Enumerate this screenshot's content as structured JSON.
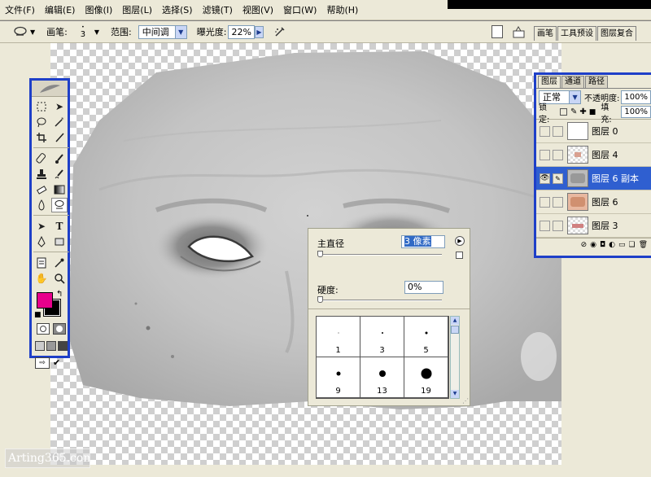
{
  "menu": {
    "items": [
      "文件(F)",
      "编辑(E)",
      "图像(I)",
      "图层(L)",
      "选择(S)",
      "滤镜(T)",
      "视图(V)",
      "窗口(W)",
      "帮助(H)"
    ]
  },
  "options_bar": {
    "tool_icon": "dodge-tool-icon",
    "brush_label": "画笔:",
    "brush_size": "3",
    "range_label": "范围:",
    "range_value": "中间调",
    "exposure_label": "曝光度:",
    "exposure_value": "22%",
    "airbrush_icon": "airbrush-icon"
  },
  "palette_well": {
    "tabs": [
      "画笔",
      "工具预设",
      "图层复合"
    ]
  },
  "toolbox": {
    "fg_color": "#E8008C",
    "bg_color": "#000000",
    "tools": [
      "marquee-icon",
      "move-icon",
      "lasso-icon",
      "magic-wand-icon",
      "crop-icon",
      "slice-icon",
      "healing-brush-icon",
      "brush-icon",
      "clone-stamp-icon",
      "history-brush-icon",
      "eraser-icon",
      "gradient-icon",
      "blur-icon",
      "dodge-icon",
      "path-select-icon",
      "type-icon",
      "pen-icon",
      "shape-icon",
      "notes-icon",
      "eyedropper-icon",
      "hand-icon",
      "zoom-icon"
    ]
  },
  "layers_panel": {
    "tabs": [
      "图层",
      "通道",
      "路径"
    ],
    "blend_mode": "正常",
    "opacity_label": "不透明度:",
    "opacity_value": "100%",
    "lock_label": "锁定:",
    "fill_label": "填充:",
    "fill_value": "100%",
    "layers": [
      {
        "name": "图层 0",
        "visible": false,
        "selected": false
      },
      {
        "name": "图层 4",
        "visible": false,
        "selected": false
      },
      {
        "name": "图层 6 副本",
        "visible": true,
        "selected": true
      },
      {
        "name": "图层 6",
        "visible": false,
        "selected": false
      },
      {
        "name": "图层 3",
        "visible": false,
        "selected": false
      }
    ]
  },
  "brush_popup": {
    "diameter_label": "主直径",
    "diameter_value": "3 像素",
    "hardness_label": "硬度:",
    "hardness_value": "0%",
    "presets": [
      {
        "size": "1"
      },
      {
        "size": "3"
      },
      {
        "size": "5"
      },
      {
        "size": "9"
      },
      {
        "size": "13"
      },
      {
        "size": "19"
      }
    ]
  },
  "watermark": "Arting365.com"
}
